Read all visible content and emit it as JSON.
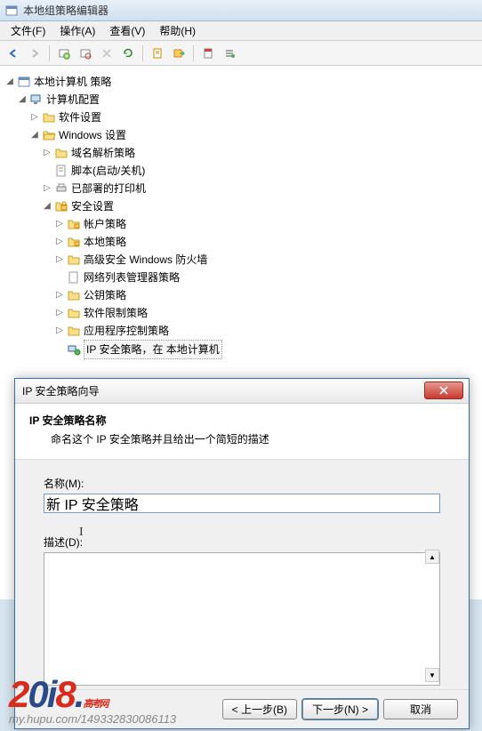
{
  "window": {
    "title": "本地组策略编辑器"
  },
  "menu": {
    "file": "文件(F)",
    "action": "操作(A)",
    "view": "查看(V)",
    "help": "帮助(H)"
  },
  "tree": {
    "root": "本地计算机 策略",
    "computer_config": "计算机配置",
    "software_settings": "软件设置",
    "windows_settings": "Windows 设置",
    "name_resolution": "域名解析策略",
    "scripts": "脚本(启动/关机)",
    "deployed_printers": "已部署的打印机",
    "security_settings": "安全设置",
    "account_policies": "帐户策略",
    "local_policies": "本地策略",
    "windows_firewall": "高级安全 Windows 防火墙",
    "network_list": "网络列表管理器策略",
    "public_key": "公钥策略",
    "software_restriction": "软件限制策略",
    "app_control": "应用程序控制策略",
    "ip_security": "IP 安全策略，在 本地计算机"
  },
  "dialog": {
    "title": "IP 安全策略向导",
    "header": "IP 安全策略名称",
    "sub": "命名这个 IP 安全策略并且给出一个简短的描述",
    "name_label": "名称(M):",
    "name_value": "新 IP 安全策略",
    "desc_label": "描述(D):",
    "desc_value": "",
    "back": "< 上一步(B)",
    "next": "下一步(N) >",
    "cancel": "取消"
  },
  "watermark": {
    "url": "my.hupu.com/14933283​0086113",
    "tag": "高考网"
  }
}
